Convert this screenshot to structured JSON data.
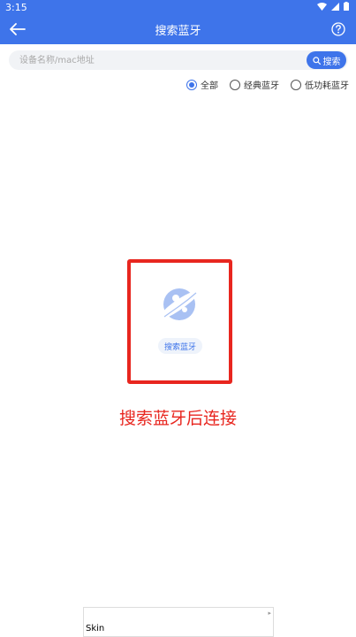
{
  "status": {
    "time": "3:15"
  },
  "toolbar": {
    "title": "搜索蓝牙",
    "back_icon": "arrow-left-icon",
    "help_icon": "question-circle-icon"
  },
  "search": {
    "placeholder": "设备名称/mac地址",
    "value": "",
    "button_label": "搜索"
  },
  "filters": [
    {
      "label": "全部",
      "selected": true
    },
    {
      "label": "经典蓝牙",
      "selected": false
    },
    {
      "label": "低功耗蓝牙",
      "selected": false
    }
  ],
  "empty_state": {
    "button_label": "搜索蓝牙",
    "hint": "搜索蓝牙后连接",
    "icon": "planet-icon"
  },
  "ad": {
    "label": "Skin",
    "mark": "▸"
  },
  "colors": {
    "primary": "#3e74ea",
    "accent_red": "#e8261f",
    "search_bg": "#f1f3f6"
  }
}
